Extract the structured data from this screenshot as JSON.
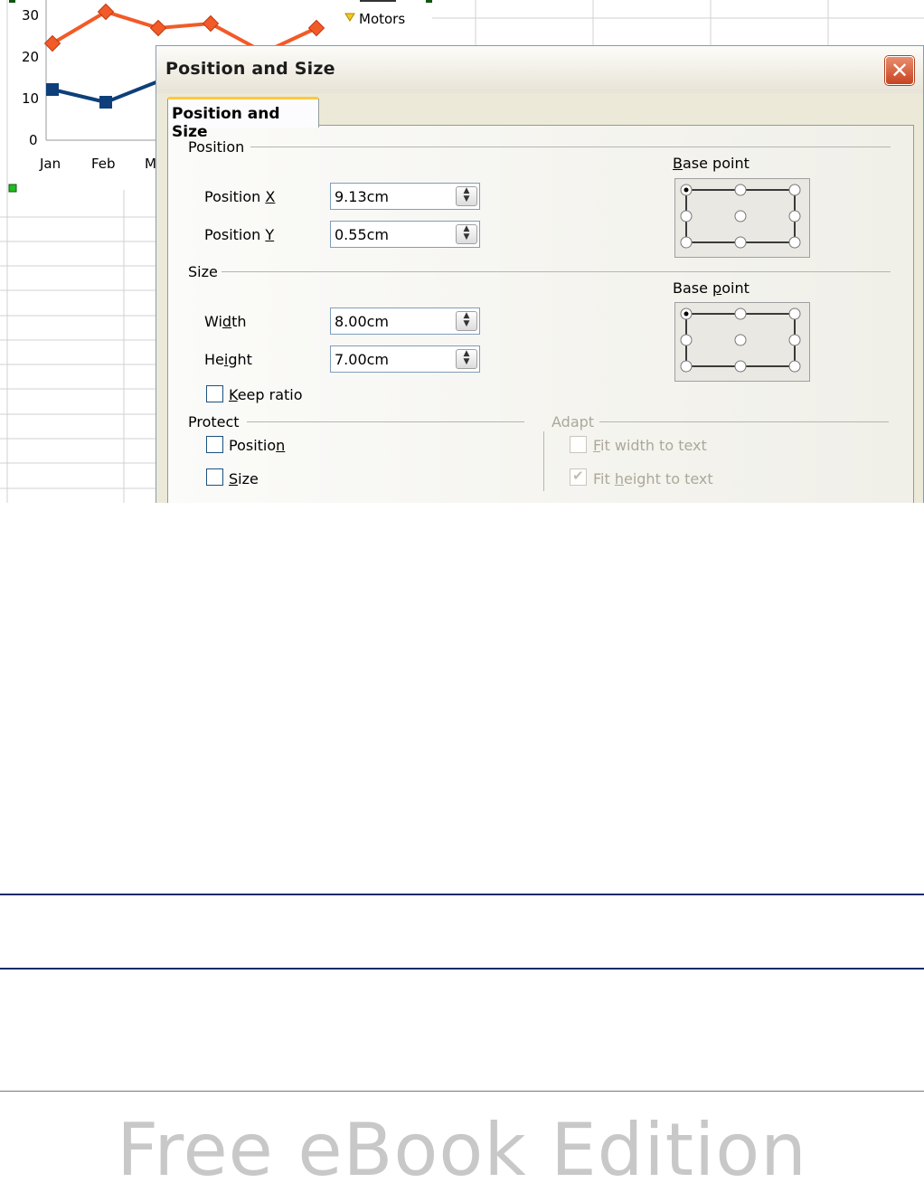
{
  "background_chart": {
    "y_ticks": [
      "30",
      "20",
      "10",
      "0"
    ],
    "x_ticks": [
      "Jan",
      "Feb",
      "M"
    ],
    "legend_item": "Motors",
    "series_colors": {
      "orange": "#f25a28",
      "blue": "#0e3f7a"
    }
  },
  "dialog": {
    "title": "Position and Size",
    "close_glyph": "✕",
    "tab_label": "Position and Size",
    "position": {
      "group_label": "Position",
      "x_label_pre": "Position ",
      "x_label_key": "X",
      "x_value": "9.13cm",
      "y_label_pre": "Position ",
      "y_label_key": "Y",
      "y_value": "0.55cm",
      "base_point_pre": "",
      "base_point_key": "B",
      "base_point_post": "ase point"
    },
    "size": {
      "group_label": "Size",
      "width_pre": "Wi",
      "width_key": "d",
      "width_post": "th",
      "width_value": "8.00cm",
      "height_pre": "He",
      "height_key": "i",
      "height_post": "ght",
      "height_value": "7.00cm",
      "keep_ratio_key": "K",
      "keep_ratio_post": "eep ratio",
      "base_point_pre": "Base ",
      "base_point_key": "p",
      "base_point_post": "oint"
    },
    "protect": {
      "group_label": "Protect",
      "position_pre": "Positio",
      "position_key": "n",
      "size_key": "S",
      "size_post": "ize"
    },
    "adapt": {
      "group_label": "Adapt",
      "fit_width_key": "F",
      "fit_width_post": "it width to text",
      "fit_height_pre": "Fit ",
      "fit_height_key": "h",
      "fit_height_post": "eight to text"
    }
  },
  "footer": {
    "watermark": "Free eBook Edition"
  }
}
